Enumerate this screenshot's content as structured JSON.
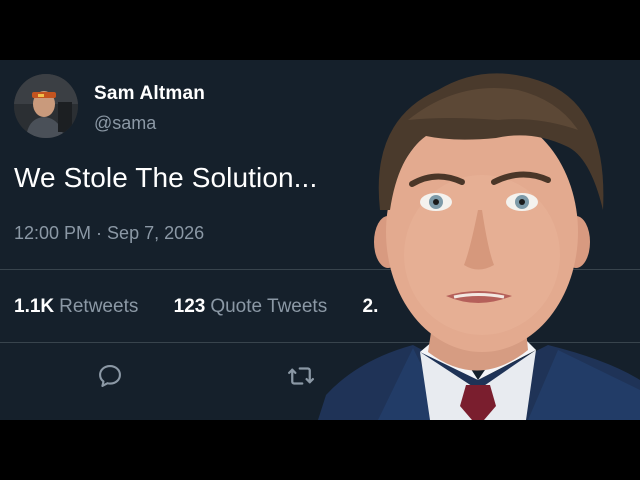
{
  "tweet": {
    "display_name": "Sam Altman",
    "handle": "@sama",
    "text": "We Stole The Solution...",
    "time": "12:00 PM",
    "date": "Sep 7, 2026",
    "stats": [
      {
        "value": "1.1K",
        "label": "Retweets"
      },
      {
        "value": "123",
        "label": "Quote Tweets"
      },
      {
        "value": "2.",
        "label": ""
      }
    ],
    "actions": {
      "reply_icon": "reply-icon",
      "retweet_icon": "retweet-icon"
    }
  },
  "colors": {
    "card_background": "#15202b",
    "primary_text": "#ffffff",
    "secondary_text": "#8b98a5",
    "divider": "#38444d",
    "letterbox": "#000000"
  }
}
